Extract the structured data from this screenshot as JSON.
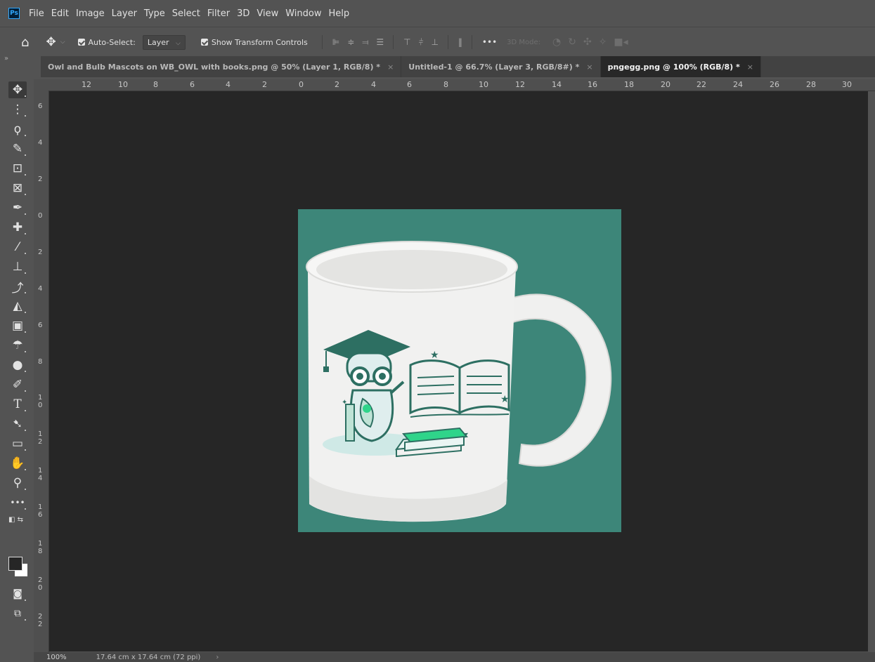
{
  "app": {
    "logo": "Ps",
    "menu": [
      "File",
      "Edit",
      "Image",
      "Layer",
      "Type",
      "Select",
      "Filter",
      "3D",
      "View",
      "Window",
      "Help"
    ]
  },
  "options": {
    "auto_select_label": "Auto-Select:",
    "auto_select_target": "Layer",
    "show_transform_label": "Show Transform Controls",
    "more_label": "•••",
    "mode_3d_label": "3D Mode:"
  },
  "tabs": [
    {
      "label": "Owl and Bulb Mascots on WB_OWL with books.png @ 50% (Layer 1, RGB/8) *",
      "active": false
    },
    {
      "label": "Untitled-1 @ 66.7% (Layer 3, RGB/8#) *",
      "active": false
    },
    {
      "label": "pngegg.png @ 100% (RGB/8) *",
      "active": true
    }
  ],
  "tab_close": "×",
  "ruler": {
    "top": [
      "12",
      "10",
      "8",
      "6",
      "4",
      "2",
      "0",
      "2",
      "4",
      "6",
      "8",
      "10",
      "12",
      "14",
      "16",
      "18",
      "20",
      "22",
      "24",
      "26",
      "28",
      "30"
    ],
    "left": [
      "6",
      "4",
      "2",
      "0",
      "2",
      "4",
      "6",
      "8",
      "10",
      "12",
      "14",
      "16",
      "18",
      "20",
      "22"
    ]
  },
  "status": {
    "zoom": "100%",
    "doc_size": "17.64 cm x 17.64 cm (72 ppi)",
    "arrow": "›"
  },
  "tools": [
    "move-tool-icon",
    "artboard-tool-icon",
    "lasso-tool-icon",
    "quick-selection-tool-icon",
    "crop-tool-icon",
    "frame-tool-icon",
    "eyedropper-tool-icon",
    "healing-brush-tool-icon",
    "brush-tool-icon",
    "clone-stamp-tool-icon",
    "history-brush-tool-icon",
    "eraser-tool-icon",
    "gradient-tool-icon",
    "blur-tool-icon",
    "dodge-tool-icon",
    "pen-tool-icon",
    "type-tool-icon",
    "path-selection-tool-icon",
    "rectangle-tool-icon",
    "hand-tool-icon",
    "zoom-tool-icon",
    "more-tools-icon"
  ],
  "colors": {
    "doc_background": "#3d8679",
    "mug": "#f1f1f0",
    "ink": "#2d6f62",
    "accent_green": "#2fd48a"
  }
}
